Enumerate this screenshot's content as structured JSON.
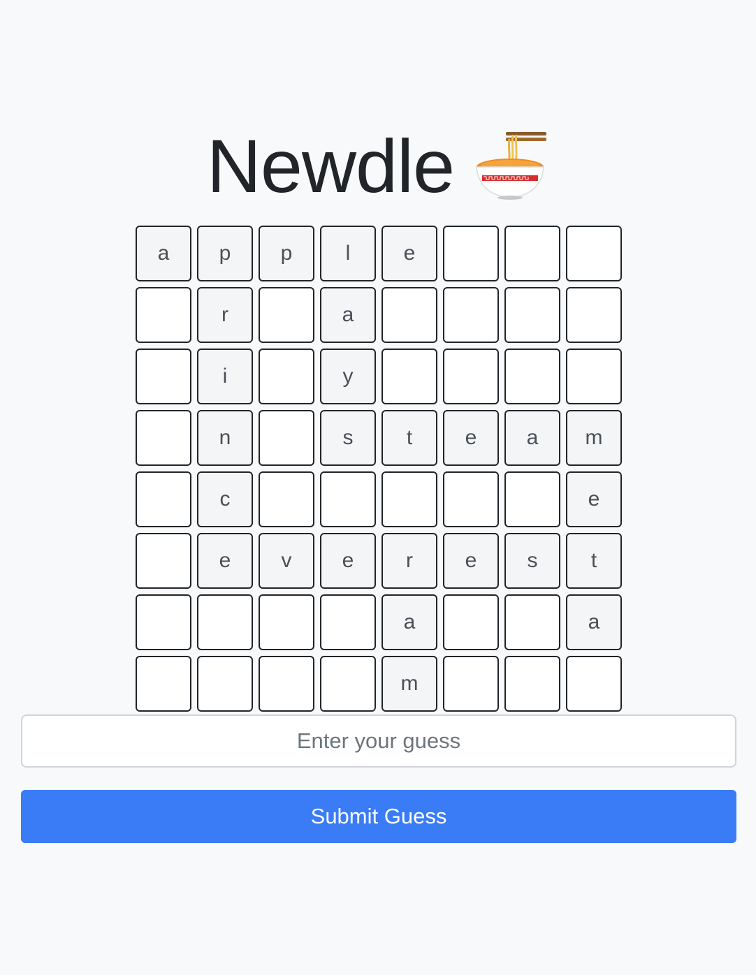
{
  "header": {
    "title": "Newdle",
    "icon": "steaming-bowl-icon"
  },
  "grid": {
    "columns": 8,
    "rows": [
      [
        "a",
        "p",
        "p",
        "l",
        "e",
        "",
        "",
        ""
      ],
      [
        "",
        "r",
        "",
        "a",
        "",
        "",
        "",
        ""
      ],
      [
        "",
        "i",
        "",
        "y",
        "",
        "",
        "",
        ""
      ],
      [
        "",
        "n",
        "",
        "s",
        "t",
        "e",
        "a",
        "m"
      ],
      [
        "",
        "c",
        "",
        "",
        "",
        "",
        "",
        "e"
      ],
      [
        "",
        "e",
        "v",
        "e",
        "r",
        "e",
        "s",
        "t"
      ],
      [
        "",
        "",
        "",
        "",
        "a",
        "",
        "",
        "a"
      ],
      [
        "",
        "",
        "",
        "",
        "m",
        "",
        "",
        ""
      ]
    ]
  },
  "guess": {
    "value": "",
    "placeholder": "Enter your guess"
  },
  "submit": {
    "label": "Submit Guess",
    "color": "#3a7cf5"
  }
}
